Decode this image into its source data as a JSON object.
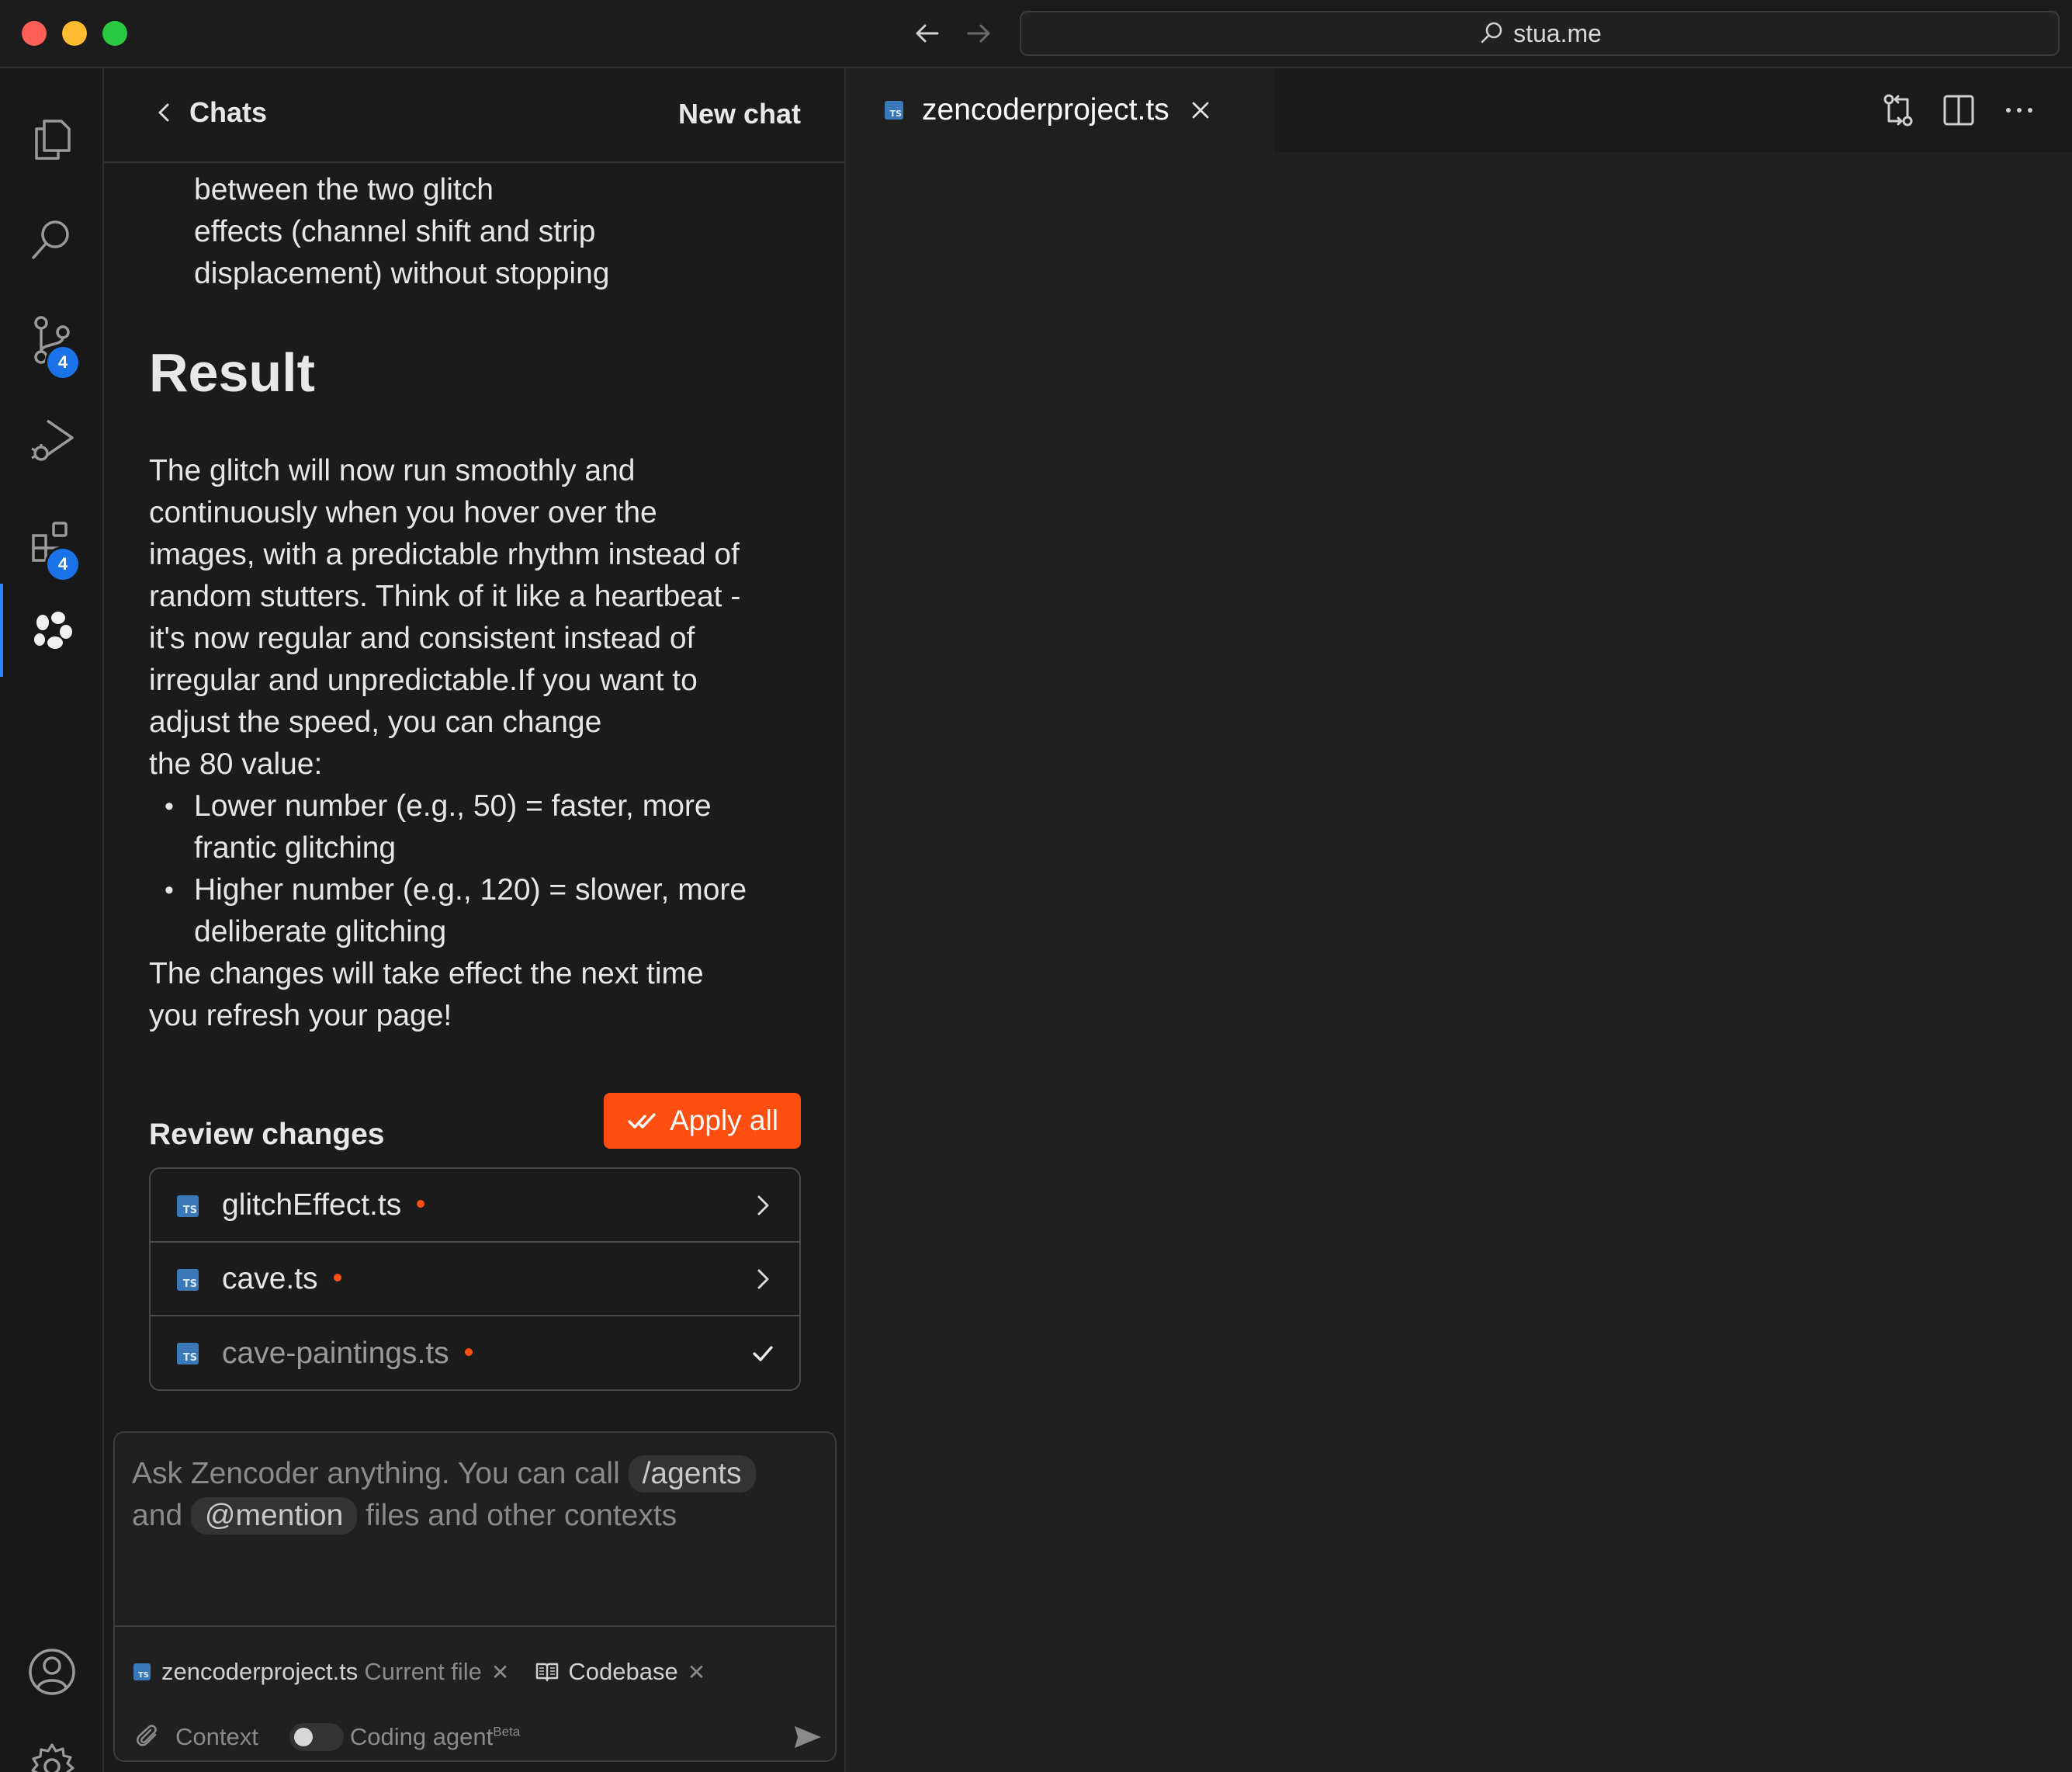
{
  "address_bar": {
    "text": "stua.me"
  },
  "activity_bar": {
    "items": [
      {
        "id": "explorer",
        "icon": "files-icon"
      },
      {
        "id": "search",
        "icon": "search-icon"
      },
      {
        "id": "source-control",
        "icon": "source-control-icon",
        "badge": "4"
      },
      {
        "id": "run-debug",
        "icon": "run-debug-icon"
      },
      {
        "id": "extensions",
        "icon": "extensions-icon",
        "badge": "4"
      },
      {
        "id": "zencoder",
        "icon": "zencoder-logo-icon",
        "active": true
      }
    ],
    "bottom": [
      {
        "id": "account",
        "icon": "account-icon"
      },
      {
        "id": "settings",
        "icon": "gear-icon"
      }
    ]
  },
  "chat": {
    "back_label": "Chats",
    "new_chat_label": "New chat",
    "message": {
      "top_partial_lines": [
        "between the two glitch",
        "effects (channel shift and strip",
        "displacement) without stopping"
      ],
      "result_heading": "Result",
      "paragraph_lines": [
        "The glitch will now run smoothly and",
        "continuously when you hover over the",
        "images, with a predictable rhythm instead of",
        "random stutters. Think of it like a heartbeat -",
        "it's now regular and consistent instead of",
        "irregular and unpredictable.If you want to",
        "adjust the speed, you can change",
        "the 80 value:"
      ],
      "bullets": [
        [
          "Lower number (e.g., 50) = faster, more",
          "frantic glitching"
        ],
        [
          "Higher number (e.g., 120) = slower, more",
          "deliberate glitching"
        ]
      ],
      "closing_lines": [
        "The changes will take effect the next time",
        "you refresh your page!"
      ]
    },
    "review": {
      "title": "Review changes",
      "apply_label": "Apply all",
      "files": [
        {
          "name": "glitchEffect.ts",
          "state": "pending"
        },
        {
          "name": "cave.ts",
          "state": "pending"
        },
        {
          "name": "cave-paintings.ts",
          "state": "applied"
        }
      ]
    },
    "input": {
      "placeholder_start": "Ask Zencoder anything. You can call",
      "pill_agents": "/agents",
      "placeholder_and": "and",
      "pill_mention": "@mention",
      "placeholder_end": "files and other contexts",
      "context_file": "zencoderproject.ts",
      "context_file_tag": "Current file",
      "context_codebase": "Codebase",
      "context_button": "Context",
      "agent_toggle_label": "Coding agent",
      "agent_toggle_badge": "Beta",
      "agent_toggle_on": false
    }
  },
  "editor": {
    "tabs": [
      {
        "label": "zencoderproject.ts",
        "icon": "ts-file-icon",
        "active": true
      }
    ],
    "toolbar": [
      "compare-changes-icon",
      "split-editor-icon",
      "more-actions-icon"
    ]
  },
  "colors": {
    "accent": "#ff4f10",
    "badge": "#1a73e8",
    "active_indicator": "#2f80ff"
  }
}
